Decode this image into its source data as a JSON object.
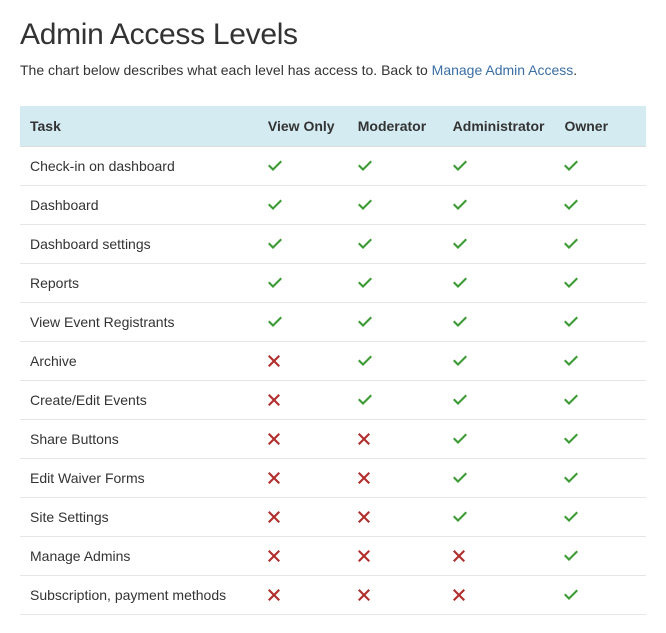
{
  "title": "Admin Access Levels",
  "subtitle_prefix": "The chart below describes what each level has access to. Back to ",
  "subtitle_link": "Manage Admin Access",
  "subtitle_suffix": ".",
  "columns": {
    "task": "Task",
    "roles": [
      "View Only",
      "Moderator",
      "Administrator",
      "Owner"
    ]
  },
  "rows": [
    {
      "task": "Check-in on dashboard",
      "access": [
        true,
        true,
        true,
        true
      ]
    },
    {
      "task": "Dashboard",
      "access": [
        true,
        true,
        true,
        true
      ]
    },
    {
      "task": "Dashboard settings",
      "access": [
        true,
        true,
        true,
        true
      ]
    },
    {
      "task": "Reports",
      "access": [
        true,
        true,
        true,
        true
      ]
    },
    {
      "task": "View Event Registrants",
      "access": [
        true,
        true,
        true,
        true
      ]
    },
    {
      "task": "Archive",
      "access": [
        false,
        true,
        true,
        true
      ]
    },
    {
      "task": "Create/Edit Events",
      "access": [
        false,
        true,
        true,
        true
      ]
    },
    {
      "task": "Share Buttons",
      "access": [
        false,
        false,
        true,
        true
      ]
    },
    {
      "task": "Edit Waiver Forms",
      "access": [
        false,
        false,
        true,
        true
      ]
    },
    {
      "task": "Site Settings",
      "access": [
        false,
        false,
        true,
        true
      ]
    },
    {
      "task": "Manage Admins",
      "access": [
        false,
        false,
        false,
        true
      ]
    },
    {
      "task": "Subscription, payment methods",
      "access": [
        false,
        false,
        false,
        true
      ]
    }
  ]
}
